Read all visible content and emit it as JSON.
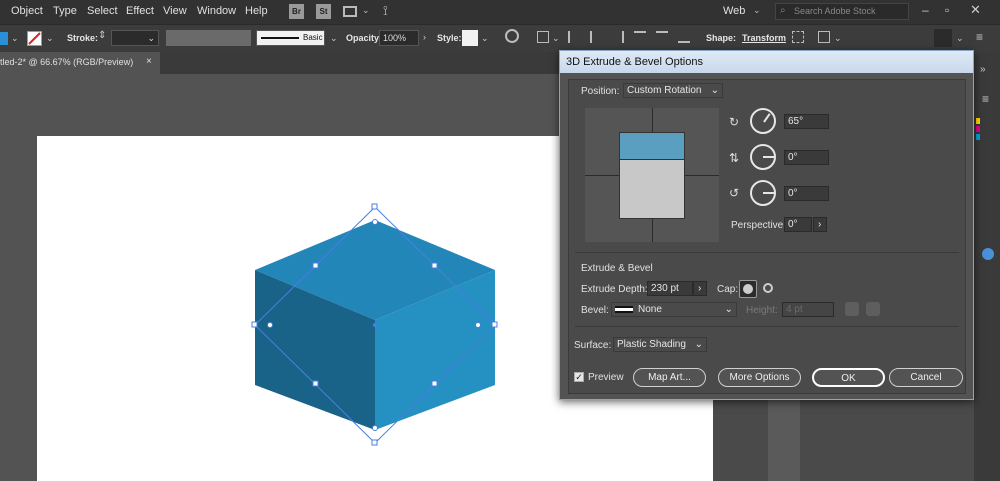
{
  "menu": [
    "Object",
    "Type",
    "Select",
    "Effect",
    "View",
    "Window",
    "Help"
  ],
  "app_icons": [
    "Br",
    "St"
  ],
  "workspace": "Web",
  "search_placeholder": "Search Adobe Stock",
  "control": {
    "stroke_label": "Stroke:",
    "brush_label": "Basic",
    "opacity_label": "Opacity:",
    "opacity_value": "100%",
    "style_label": "Style:",
    "shape_label": "Shape:",
    "transform_label": "Transform"
  },
  "document_tab": "tled-2* @ 66.67% (RGB/Preview)",
  "dialog": {
    "title": "3D Extrude & Bevel Options",
    "position_label": "Position:",
    "position_value": "Custom Rotation",
    "rot_x": "65°",
    "rot_y": "0°",
    "rot_z": "0°",
    "perspective_label": "Perspective:",
    "perspective_value": "0°",
    "extrude_section": "Extrude & Bevel",
    "extrude_depth_label": "Extrude Depth:",
    "extrude_depth_value": "230 pt",
    "cap_label": "Cap:",
    "bevel_label": "Bevel:",
    "bevel_value": "None",
    "height_label": "Height:",
    "height_value": "4 pt",
    "surface_label": "Surface:",
    "surface_value": "Plastic Shading",
    "preview_label": "Preview",
    "map_art_button": "Map Art...",
    "more_options_button": "More Options",
    "ok_button": "OK",
    "cancel_button": "Cancel"
  },
  "colors": {
    "cube_top": "#2386b8",
    "cube_left": "#1a6388",
    "cube_right": "#2590c2",
    "selection": "#4a7fe0"
  }
}
